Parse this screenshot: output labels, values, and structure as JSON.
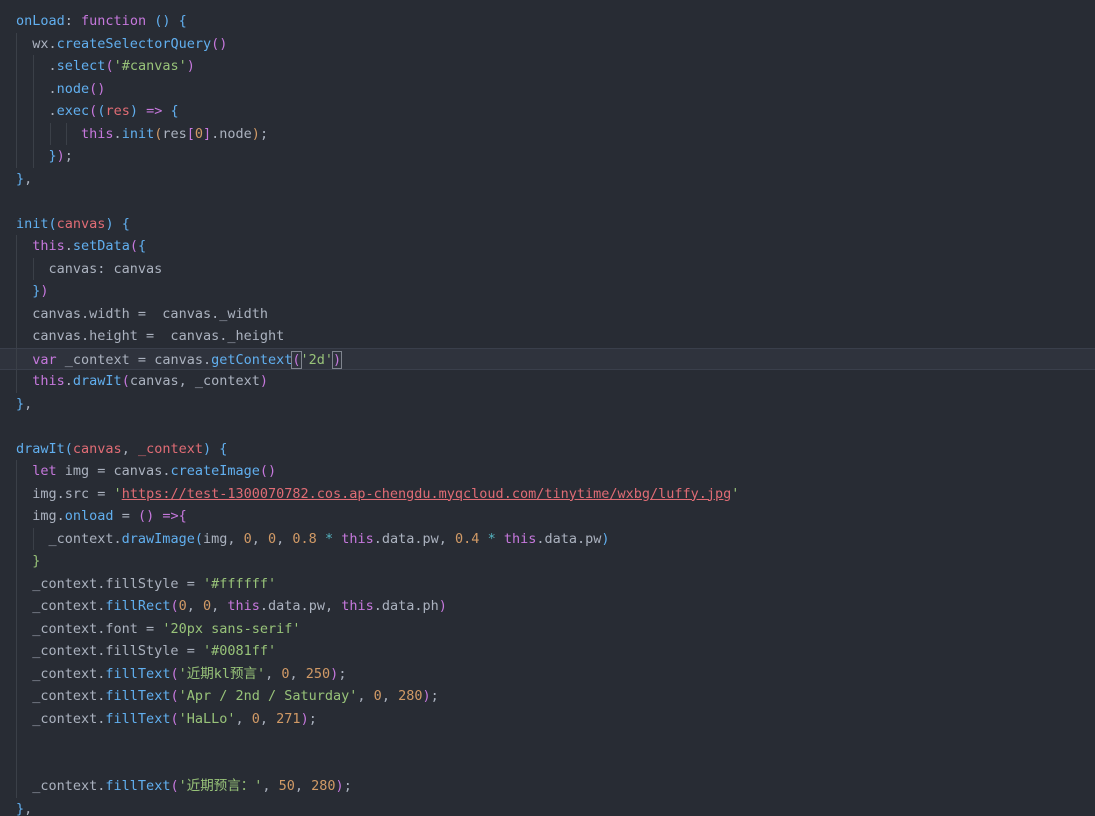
{
  "editor": {
    "theme": "dark",
    "background": "#282c34",
    "lines": [
      {
        "indent": 0,
        "guides": 0,
        "tokens": [
          [
            "fn",
            "onLoad"
          ],
          [
            "plain",
            ": "
          ],
          [
            "kw",
            "function"
          ],
          [
            "plain",
            " "
          ],
          [
            "br3",
            "()"
          ],
          [
            "plain",
            " "
          ],
          [
            "br3",
            "{"
          ]
        ]
      },
      {
        "indent": 1,
        "guides": 1,
        "tokens": [
          [
            "plain",
            "wx."
          ],
          [
            "fn",
            "createSelectorQuery"
          ],
          [
            "br2",
            "()"
          ]
        ]
      },
      {
        "indent": 2,
        "guides": 2,
        "tokens": [
          [
            "plain",
            "."
          ],
          [
            "fn",
            "select"
          ],
          [
            "br2",
            "("
          ],
          [
            "str",
            "'#canvas'"
          ],
          [
            "br2",
            ")"
          ]
        ]
      },
      {
        "indent": 2,
        "guides": 2,
        "tokens": [
          [
            "plain",
            "."
          ],
          [
            "fn",
            "node"
          ],
          [
            "br2",
            "()"
          ]
        ]
      },
      {
        "indent": 2,
        "guides": 2,
        "tokens": [
          [
            "plain",
            "."
          ],
          [
            "fn",
            "exec"
          ],
          [
            "br2",
            "("
          ],
          [
            "br3",
            "("
          ],
          [
            "prop",
            "res"
          ],
          [
            "br3",
            ")"
          ],
          [
            "plain",
            " "
          ],
          [
            "kw",
            "=>"
          ],
          [
            "plain",
            " "
          ],
          [
            "br3",
            "{"
          ]
        ]
      },
      {
        "indent": 4,
        "guides": 4,
        "tokens": [
          [
            "kw",
            "this"
          ],
          [
            "plain",
            "."
          ],
          [
            "fn",
            "init"
          ],
          [
            "br",
            "("
          ],
          [
            "plain",
            "res"
          ],
          [
            "br2",
            "["
          ],
          [
            "num",
            "0"
          ],
          [
            "br2",
            "]"
          ],
          [
            "plain",
            ".node"
          ],
          [
            "br",
            ")"
          ],
          [
            "plain",
            ";"
          ]
        ]
      },
      {
        "indent": 2,
        "guides": 2,
        "tokens": [
          [
            "br3",
            "}"
          ],
          [
            "br2",
            ")"
          ],
          [
            "plain",
            ";"
          ]
        ]
      },
      {
        "indent": 0,
        "guides": 0,
        "tokens": [
          [
            "br3",
            "}"
          ],
          [
            "plain",
            ","
          ]
        ]
      },
      {
        "indent": 0,
        "guides": 0,
        "tokens": []
      },
      {
        "indent": 0,
        "guides": 0,
        "tokens": [
          [
            "fn",
            "init"
          ],
          [
            "br3",
            "("
          ],
          [
            "prop",
            "canvas"
          ],
          [
            "br3",
            ")"
          ],
          [
            "plain",
            " "
          ],
          [
            "br3",
            "{"
          ]
        ]
      },
      {
        "indent": 1,
        "guides": 1,
        "tokens": [
          [
            "kw",
            "this"
          ],
          [
            "plain",
            "."
          ],
          [
            "fn",
            "setData"
          ],
          [
            "br2",
            "("
          ],
          [
            "br3",
            "{"
          ]
        ]
      },
      {
        "indent": 2,
        "guides": 2,
        "tokens": [
          [
            "plain",
            "canvas: canvas"
          ]
        ]
      },
      {
        "indent": 1,
        "guides": 1,
        "tokens": [
          [
            "br3",
            "}"
          ],
          [
            "br2",
            ")"
          ]
        ]
      },
      {
        "indent": 1,
        "guides": 1,
        "tokens": [
          [
            "plain",
            "canvas.width =  canvas._width"
          ]
        ]
      },
      {
        "indent": 1,
        "guides": 1,
        "tokens": [
          [
            "plain",
            "canvas.height =  canvas._height"
          ]
        ]
      },
      {
        "indent": 1,
        "guides": 1,
        "active": true,
        "tokens": [
          [
            "kw",
            "var"
          ],
          [
            "plain",
            " _context = canvas."
          ],
          [
            "fn",
            "getContext"
          ],
          [
            "br2h",
            "("
          ],
          [
            "str",
            "'2d'"
          ],
          [
            "br2h",
            ")"
          ]
        ]
      },
      {
        "indent": 1,
        "guides": 1,
        "tokens": [
          [
            "kw",
            "this"
          ],
          [
            "plain",
            "."
          ],
          [
            "fn",
            "drawIt"
          ],
          [
            "br2",
            "("
          ],
          [
            "plain",
            "canvas, _context"
          ],
          [
            "br2",
            ")"
          ]
        ]
      },
      {
        "indent": 0,
        "guides": 0,
        "tokens": [
          [
            "br3",
            "}"
          ],
          [
            "plain",
            ","
          ]
        ]
      },
      {
        "indent": 0,
        "guides": 0,
        "tokens": []
      },
      {
        "indent": 0,
        "guides": 0,
        "tokens": [
          [
            "fn",
            "drawIt"
          ],
          [
            "br3",
            "("
          ],
          [
            "prop",
            "canvas"
          ],
          [
            "plain",
            ", "
          ],
          [
            "prop",
            "_context"
          ],
          [
            "br3",
            ")"
          ],
          [
            "plain",
            " "
          ],
          [
            "br3",
            "{"
          ]
        ]
      },
      {
        "indent": 1,
        "guides": 1,
        "tokens": [
          [
            "kw",
            "let"
          ],
          [
            "plain",
            " img = canvas."
          ],
          [
            "fn",
            "createImage"
          ],
          [
            "br2",
            "()"
          ]
        ]
      },
      {
        "indent": 1,
        "guides": 1,
        "tokens": [
          [
            "plain",
            "img.src = "
          ],
          [
            "str",
            "'"
          ],
          [
            "url",
            "https://test-1300070782.cos.ap-chengdu.myqcloud.com/tinytime/wxbg/luffy.jpg"
          ],
          [
            "str",
            "'"
          ]
        ]
      },
      {
        "indent": 1,
        "guides": 1,
        "tokens": [
          [
            "plain",
            "img."
          ],
          [
            "fn",
            "onload"
          ],
          [
            "plain",
            " = "
          ],
          [
            "br2",
            "()"
          ],
          [
            "plain",
            " "
          ],
          [
            "kw",
            "=>"
          ],
          [
            "br2",
            "{"
          ]
        ]
      },
      {
        "indent": 2,
        "guides": 2,
        "tokens": [
          [
            "plain",
            "_context."
          ],
          [
            "fn",
            "drawImage"
          ],
          [
            "br3",
            "("
          ],
          [
            "plain",
            "img, "
          ],
          [
            "num",
            "0"
          ],
          [
            "plain",
            ", "
          ],
          [
            "num",
            "0"
          ],
          [
            "plain",
            ", "
          ],
          [
            "num",
            "0.8"
          ],
          [
            "plain",
            " "
          ],
          [
            "op",
            "*"
          ],
          [
            "plain",
            " "
          ],
          [
            "kw",
            "this"
          ],
          [
            "plain",
            ".data.pw, "
          ],
          [
            "num",
            "0.4"
          ],
          [
            "plain",
            " "
          ],
          [
            "op",
            "*"
          ],
          [
            "plain",
            " "
          ],
          [
            "kw",
            "this"
          ],
          [
            "plain",
            ".data.pw"
          ],
          [
            "br3",
            ")"
          ]
        ]
      },
      {
        "indent": 1,
        "guides": 1,
        "tokens": [
          [
            "str",
            "}"
          ]
        ]
      },
      {
        "indent": 1,
        "guides": 1,
        "tokens": [
          [
            "plain",
            "_context.fillStyle = "
          ],
          [
            "str",
            "'#ffffff'"
          ]
        ]
      },
      {
        "indent": 1,
        "guides": 1,
        "tokens": [
          [
            "plain",
            "_context."
          ],
          [
            "fn",
            "fillRect"
          ],
          [
            "br2",
            "("
          ],
          [
            "num",
            "0"
          ],
          [
            "plain",
            ", "
          ],
          [
            "num",
            "0"
          ],
          [
            "plain",
            ", "
          ],
          [
            "kw",
            "this"
          ],
          [
            "plain",
            ".data.pw, "
          ],
          [
            "kw",
            "this"
          ],
          [
            "plain",
            ".data.ph"
          ],
          [
            "br2",
            ")"
          ]
        ]
      },
      {
        "indent": 1,
        "guides": 1,
        "tokens": [
          [
            "plain",
            "_context.font = "
          ],
          [
            "str",
            "'20px sans-serif'"
          ]
        ]
      },
      {
        "indent": 1,
        "guides": 1,
        "tokens": [
          [
            "plain",
            "_context.fillStyle = "
          ],
          [
            "str",
            "'#0081ff'"
          ]
        ]
      },
      {
        "indent": 1,
        "guides": 1,
        "tokens": [
          [
            "plain",
            "_context."
          ],
          [
            "fn",
            "fillText"
          ],
          [
            "br2",
            "("
          ],
          [
            "str",
            "'近期kl预言'"
          ],
          [
            "plain",
            ", "
          ],
          [
            "num",
            "0"
          ],
          [
            "plain",
            ", "
          ],
          [
            "num",
            "250"
          ],
          [
            "br2",
            ")"
          ],
          [
            "plain",
            ";"
          ]
        ]
      },
      {
        "indent": 1,
        "guides": 1,
        "tokens": [
          [
            "plain",
            "_context."
          ],
          [
            "fn",
            "fillText"
          ],
          [
            "br2",
            "("
          ],
          [
            "str",
            "'Apr / 2nd / Saturday'"
          ],
          [
            "plain",
            ", "
          ],
          [
            "num",
            "0"
          ],
          [
            "plain",
            ", "
          ],
          [
            "num",
            "280"
          ],
          [
            "br2",
            ")"
          ],
          [
            "plain",
            ";"
          ]
        ]
      },
      {
        "indent": 1,
        "guides": 1,
        "tokens": [
          [
            "plain",
            "_context."
          ],
          [
            "fn",
            "fillText"
          ],
          [
            "br2",
            "("
          ],
          [
            "str",
            "'HaLLo'"
          ],
          [
            "plain",
            ", "
          ],
          [
            "num",
            "0"
          ],
          [
            "plain",
            ", "
          ],
          [
            "num",
            "271"
          ],
          [
            "br2",
            ")"
          ],
          [
            "plain",
            ";"
          ]
        ]
      },
      {
        "indent": 0,
        "guides": 1,
        "tokens": []
      },
      {
        "indent": 0,
        "guides": 1,
        "tokens": []
      },
      {
        "indent": 1,
        "guides": 1,
        "tokens": [
          [
            "plain",
            "_context."
          ],
          [
            "fn",
            "fillText"
          ],
          [
            "br2",
            "("
          ],
          [
            "str",
            "'近期预言：'"
          ],
          [
            "plain",
            ", "
          ],
          [
            "num",
            "50"
          ],
          [
            "plain",
            ", "
          ],
          [
            "num",
            "280"
          ],
          [
            "br2",
            ")"
          ],
          [
            "plain",
            ";"
          ]
        ]
      },
      {
        "indent": 0,
        "guides": 0,
        "tokens": [
          [
            "br3",
            "}"
          ],
          [
            "plain",
            ","
          ]
        ]
      }
    ]
  }
}
